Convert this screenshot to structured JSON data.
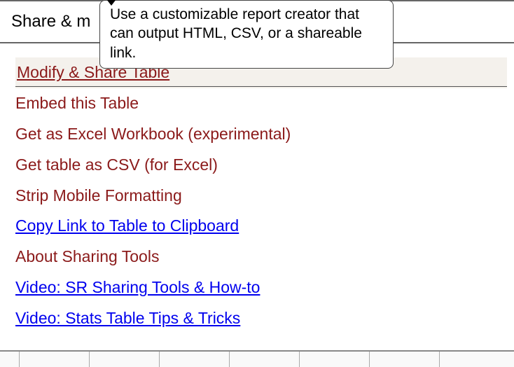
{
  "header": {
    "title_visible": "Share & m"
  },
  "tooltip": {
    "text": "Use a customizable report creator that can output HTML, CSV, or a shareable link."
  },
  "menu": {
    "items": [
      {
        "label": "Modify & Share Table",
        "style": "dark-red",
        "active": true
      },
      {
        "label": "Embed this Table",
        "style": "dark-red",
        "active": false
      },
      {
        "label": "Get as Excel Workbook (experimental)",
        "style": "dark-red",
        "active": false
      },
      {
        "label": "Get table as CSV (for Excel)",
        "style": "dark-red",
        "active": false
      },
      {
        "label": "Strip Mobile Formatting",
        "style": "dark-red",
        "active": false
      },
      {
        "label": "Copy Link to Table to Clipboard",
        "style": "blue-link",
        "active": false
      },
      {
        "label": "About Sharing Tools",
        "style": "dark-red",
        "active": false
      },
      {
        "label": "Video: SR Sharing Tools & How-to",
        "style": "blue-link",
        "active": false
      },
      {
        "label": "Video: Stats Table Tips & Tricks",
        "style": "blue-link",
        "active": false
      }
    ]
  },
  "bottom_segments_widths": [
    28,
    100,
    100,
    100,
    100,
    100,
    100,
    100
  ]
}
